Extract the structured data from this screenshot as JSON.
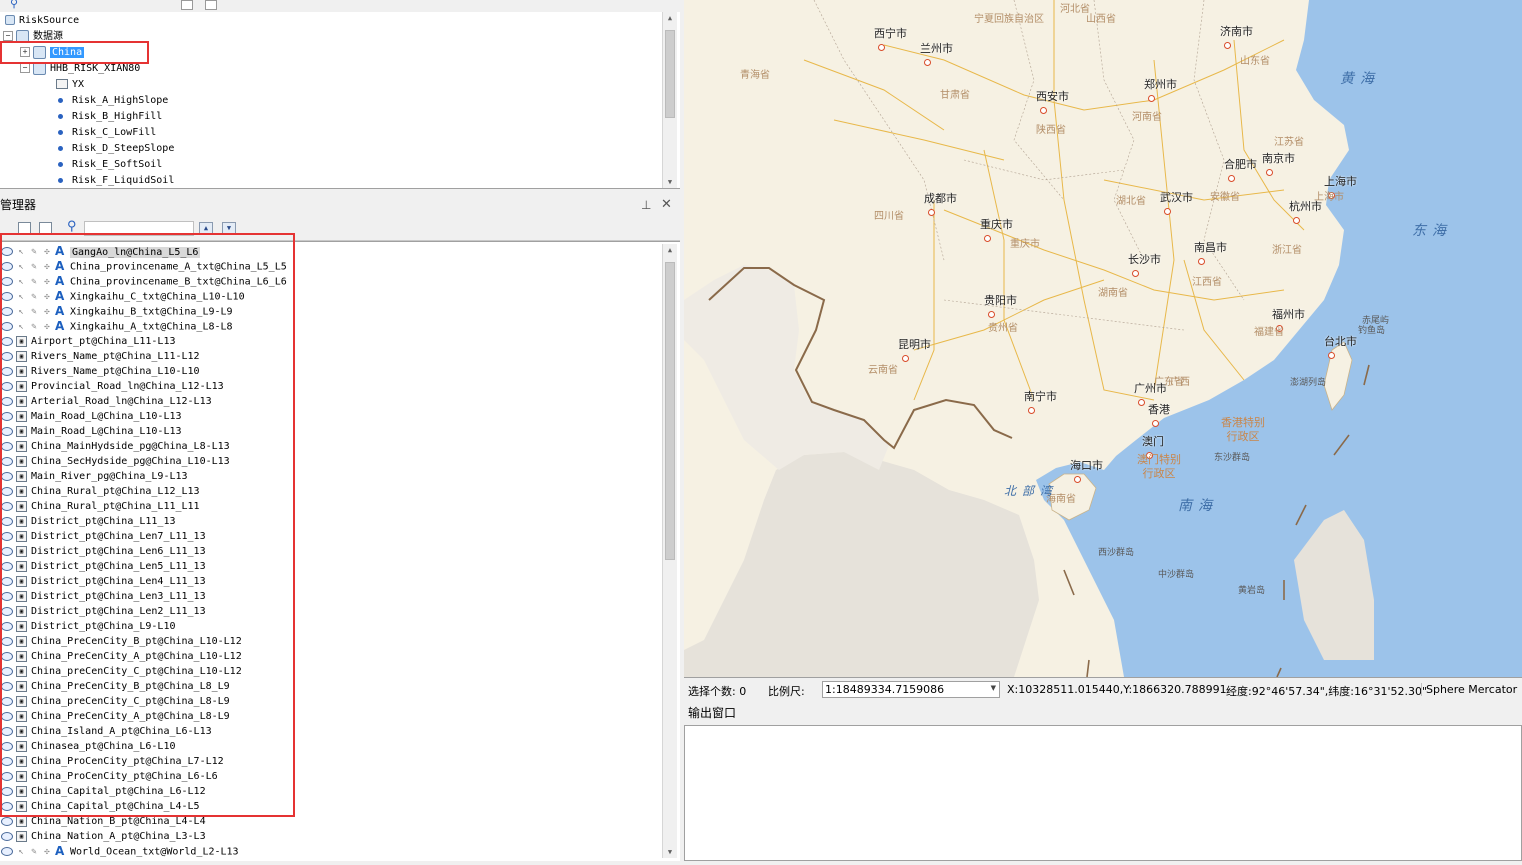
{
  "workspace": {
    "root": "RiskSource",
    "datasources_label": "数据源",
    "items": [
      {
        "label": "China",
        "selected": true
      },
      {
        "label": "HHB_RISK_XIAN80"
      },
      {
        "label": "YX"
      },
      {
        "label": "Risk_A_HighSlope"
      },
      {
        "label": "Risk_B_HighFill"
      },
      {
        "label": "Risk_C_LowFill"
      },
      {
        "label": "Risk_D_SteepSlope"
      },
      {
        "label": "Risk_E_SoftSoil"
      },
      {
        "label": "Risk_F_LiquidSoil"
      }
    ]
  },
  "layer_manager": {
    "title": "层管理器",
    "label_layers": [
      "GangAo_ln@China_L5_L6",
      "China_provincename_A_txt@China_L5_L5",
      "China_provincename_B_txt@China_L6_L6",
      "Xingkaihu_C_txt@China_L10-L10",
      "Xingkaihu_B_txt@China_L9-L9",
      "Xingkaihu_A_txt@China_L8-L8"
    ],
    "layers": [
      "Airport_pt@China_L11-L13",
      "Rivers_Name_pt@China_L11-L12",
      "Rivers_Name_pt@China_L10-L10",
      "Provincial_Road_ln@China_L12-L13",
      "Arterial_Road_ln@China_L12-L13",
      "Main_Road_L@China_L10-L13",
      "Main_Road_L@China_L10-L13",
      "China_MainHydside_pg@China_L8-L13",
      "China_SecHydside_pg@China_L10-L13",
      "Main_River_pg@China_L9-L13",
      "China_Rural_pt@China_L12_L13",
      "China_Rural_pt@China_L11_L11",
      "District_pt@China_L11_13",
      "District_pt@China_Len7_L11_13",
      "District_pt@China_Len6_L11_13",
      "District_pt@China_Len5_L11_13",
      "District_pt@China_Len4_L11_13",
      "District_pt@China_Len3_L11_13",
      "District_pt@China_Len2_L11_13",
      "District_pt@China_L9-L10",
      "China_PreCenCity_B_pt@China_L10-L12",
      "China_PreCenCity_A_pt@China_L10-L12",
      "China_preCenCity_C_pt@China_L10-L12",
      "China_PreCenCity_B_pt@China_L8_L9",
      "China_preCenCity_C_pt@China_L8-L9",
      "China_PreCenCity_A_pt@China_L8-L9",
      "China_Island_A_pt@China_L6-L13",
      "Chinasea_pt@China_L6-L10",
      "China_ProCenCity_pt@China_L7-L12",
      "China_ProCenCity_pt@China_L6-L6",
      "China_Capital_pt@China_L6-L12",
      "China_Capital_pt@China_L4-L5",
      "China_Nation_B_pt@China_L4-L4",
      "China_Nation_A_pt@China_L3-L3"
    ],
    "last_label_layer": "World_Ocean_txt@World_L2-L13"
  },
  "map": {
    "cities": [
      {
        "name": "西宁市"
      },
      {
        "name": "兰州市"
      },
      {
        "name": "西安市"
      },
      {
        "name": "郑州市"
      },
      {
        "name": "济南市"
      },
      {
        "name": "成都市"
      },
      {
        "name": "重庆市"
      },
      {
        "name": "武汉市"
      },
      {
        "name": "合肥市"
      },
      {
        "name": "南京市"
      },
      {
        "name": "上海市"
      },
      {
        "name": "杭州市"
      },
      {
        "name": "贵阳市"
      },
      {
        "name": "长沙市"
      },
      {
        "name": "南昌市"
      },
      {
        "name": "昆明市"
      },
      {
        "name": "福州市"
      },
      {
        "name": "台北市"
      },
      {
        "name": "广州市"
      },
      {
        "name": "香港"
      },
      {
        "name": "澳门"
      },
      {
        "name": "南宁市"
      },
      {
        "name": "海口市"
      }
    ],
    "provinces": [
      "青海省",
      "甘肃省",
      "陕西省",
      "河南省",
      "山东省",
      "四川省",
      "重庆市",
      "湖北省",
      "安徽省",
      "江苏省",
      "上海市",
      "浙江省",
      "贵州省",
      "湖南省",
      "江西省",
      "云南省",
      "福建省",
      "广西",
      "广东省",
      "宁夏回族自治区",
      "山西省",
      "河北省",
      "海南省"
    ],
    "seas": [
      "黄海",
      "东海",
      "南海",
      "北部湾"
    ],
    "islands": [
      "赤尾屿",
      "钓鱼岛",
      "澎湖列岛",
      "东沙群岛",
      "西沙群岛",
      "中沙群岛",
      "黄岩岛"
    ],
    "sar_labels": [
      "香港特别行政区",
      "澳门特别行政区"
    ],
    "colors": {
      "land": "#f6f1e3",
      "sea": "#9cc3ea",
      "road": "#e8b84a",
      "border": "#8a6a4a",
      "city": "#d94c2a"
    }
  },
  "status": {
    "selection_label": "选择个数: 0",
    "scale_label": "比例尺:",
    "scale_value": "1:18489334.7159086",
    "coords": "X:10328511.015440,Y:1866320.788991",
    "lonlat": "经度:92°46'57.34\",纬度:16°31'52.30\"",
    "projection": "Sphere Mercator"
  },
  "output": {
    "title": "输出窗口"
  }
}
